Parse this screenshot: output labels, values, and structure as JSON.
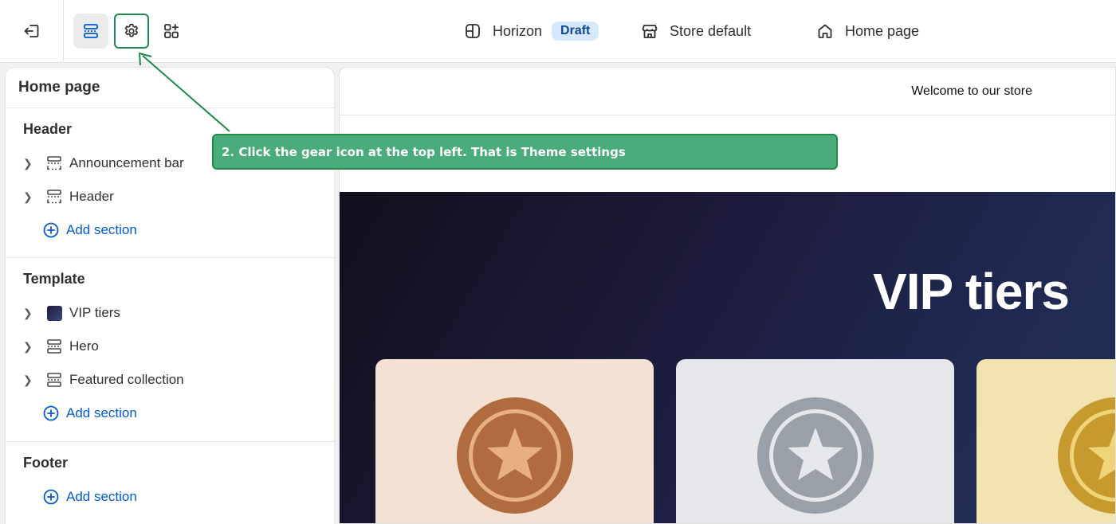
{
  "topbar": {
    "theme_name": "Horizon",
    "theme_status": "Draft",
    "store_label": "Store default",
    "page_label": "Home page"
  },
  "sidebar": {
    "title": "Home page",
    "groups": [
      {
        "title": "Header",
        "items": [
          {
            "label": "Announcement bar",
            "icon": "section-dashed-icon"
          },
          {
            "label": "Header",
            "icon": "section-dashed-icon"
          }
        ],
        "add_label": "Add section"
      },
      {
        "title": "Template",
        "items": [
          {
            "label": "VIP tiers",
            "icon": "image-thumbnail-icon"
          },
          {
            "label": "Hero",
            "icon": "section-icon"
          },
          {
            "label": "Featured collection",
            "icon": "section-icon"
          }
        ],
        "add_label": "Add section"
      },
      {
        "title": "Footer",
        "items": [],
        "add_label": "Add section"
      }
    ]
  },
  "preview": {
    "announcement_text": "Welcome to our store",
    "hero_title": "VIP tiers",
    "tier_colors": [
      "#f3e2d3",
      "#e6e7eb",
      "#f3e3b0"
    ]
  },
  "callout": {
    "text": "2. Click the gear icon at the top left. That is Theme settings"
  },
  "colors": {
    "accent_green": "#1f8a4c",
    "callout_fill": "#4aab7b",
    "link_blue": "#005bd3"
  }
}
